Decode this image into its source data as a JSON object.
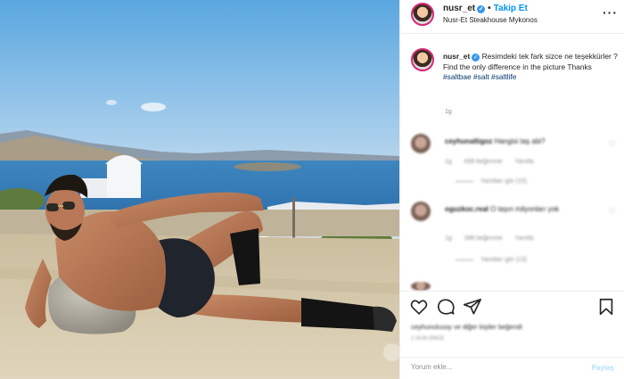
{
  "header": {
    "username": "nusr_et",
    "verified_icon": "verified-badge-icon",
    "follow_label": "Takip Et",
    "location": "Nusr-Et Steakhouse Mykonos",
    "more_icon": "more-options-icon"
  },
  "caption": {
    "username": "nusr_et",
    "text": "Resimdeki tek fark sizce ne teşekkürler ? Find the only difference in the picture Thanks",
    "hashtags": [
      "#saltbae",
      "#salt",
      "#saltlife"
    ],
    "time": "1g"
  },
  "comments": [
    {
      "username": "ceyhunaltigoz",
      "text": "Hangisi taş abi?",
      "meta": [
        "1g",
        "699 beğenme",
        "Yanıtla"
      ],
      "replies": "Yanıtları gör (15)"
    },
    {
      "username": "oguzkoc.real",
      "text": "O taşın milyonları yok",
      "meta": [
        "1g",
        "398 beğenme",
        "Yanıtla"
      ],
      "replies": "Yanıtları gör (13)"
    }
  ],
  "actions": {
    "like_icon": "heart-icon",
    "comment_icon": "comment-icon",
    "share_icon": "paper-plane-icon",
    "save_icon": "bookmark-icon"
  },
  "likes": "ceyhunulusoy ve diğer kişiler beğendi",
  "likes_date": "1 GÜN ÖNCE",
  "composer": {
    "placeholder": "Yorum ekle...",
    "post_label": "Paylaş"
  },
  "colors": {
    "accent": "#0095f6",
    "story_ring": "#d62976",
    "hashtag": "#00376b",
    "muted": "#8e8e8e"
  }
}
